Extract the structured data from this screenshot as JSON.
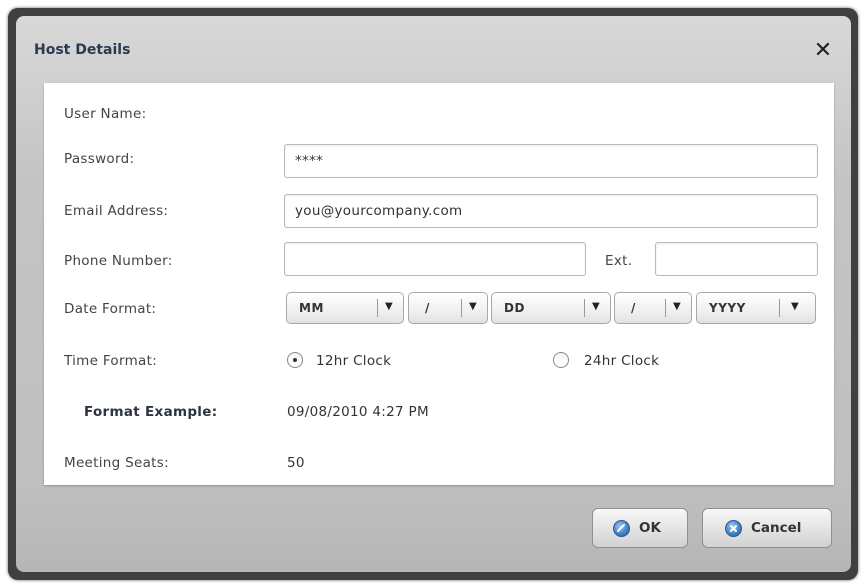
{
  "dialog": {
    "title": "Host Details",
    "close_glyph": "✕"
  },
  "form": {
    "user_name_label": "User Name:",
    "password_label": "Password:",
    "password_value": "****",
    "email_label": "Email Address:",
    "email_value": "you@yourcompany.com",
    "phone_label": "Phone Number:",
    "phone_value": "",
    "ext_label": "Ext.",
    "ext_value": "",
    "date_format_label": "Date Format:",
    "date_selects": [
      "MM",
      "/",
      "DD",
      "/",
      "YYYY"
    ],
    "time_format_label": "Time Format:",
    "time_options": [
      {
        "label": "12hr Clock",
        "selected": true
      },
      {
        "label": "24hr Clock",
        "selected": false
      }
    ],
    "format_example_label": "Format Example:",
    "format_example_value": "09/08/2010 4:27 PM",
    "meeting_seats_label": "Meeting Seats:",
    "meeting_seats_value": "50"
  },
  "buttons": {
    "ok_label": "OK",
    "cancel_label": "Cancel"
  },
  "icons": {
    "close": "close-icon",
    "ok": "ok-icon",
    "cancel": "cancel-icon",
    "dropdown": "chevron-down-icon"
  },
  "colors": {
    "frame": "#404040",
    "dialog_bg": "#c9c9c9",
    "title": "#2a3a4e",
    "button_icon": "#3f7fc4"
  }
}
